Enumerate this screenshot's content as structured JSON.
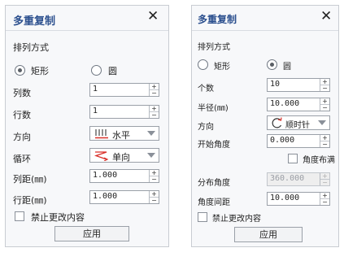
{
  "dialog1": {
    "title": "多重复制",
    "close_icon": "close-icon",
    "arrangement_label": "排列方式",
    "option_rect": "矩形",
    "option_circle": "圆",
    "selected_option": "矩形",
    "columns_label": "列数",
    "columns_value": "1",
    "rows_label": "行数",
    "rows_value": "1",
    "direction_label": "方向",
    "direction_value": "水平",
    "direction_icon": "horizontal-arrange-icon",
    "loop_label": "循环",
    "loop_value": "单向",
    "loop_icon": "zigzag-arrow-icon",
    "col_spacing_label": "列距(㎜)",
    "col_spacing_value": "1.000",
    "row_spacing_label": "行距(㎜)",
    "row_spacing_value": "1.000",
    "lock_label": "禁止更改内容",
    "lock_checked": false,
    "apply_label": "应用"
  },
  "dialog2": {
    "title": "多重复制",
    "close_icon": "close-icon",
    "arrangement_label": "排列方式",
    "option_rect": "矩形",
    "option_circle": "圆",
    "selected_option": "圆",
    "count_label": "个数",
    "count_value": "10",
    "radius_label": "半径(㎜)",
    "radius_value": "10.000",
    "direction_label": "方向",
    "direction_value": "顺时针",
    "direction_icon": "clockwise-arrow-icon",
    "start_angle_label": "开始角度",
    "start_angle_value": "0.000",
    "fill_angle_label": "角度布满",
    "fill_angle_checked": false,
    "distribution_label": "分布角度",
    "distribution_value": "360.000",
    "distribution_enabled": false,
    "angle_spacing_label": "角度间距",
    "angle_spacing_value": "10.000",
    "lock_label": "禁止更改内容",
    "lock_checked": false,
    "apply_label": "应用"
  },
  "colors": {
    "title": "#2b4f8e",
    "dialog_bg": "#f7f8fa",
    "border": "#c9ccd2",
    "icon_red": "#d9302a"
  }
}
